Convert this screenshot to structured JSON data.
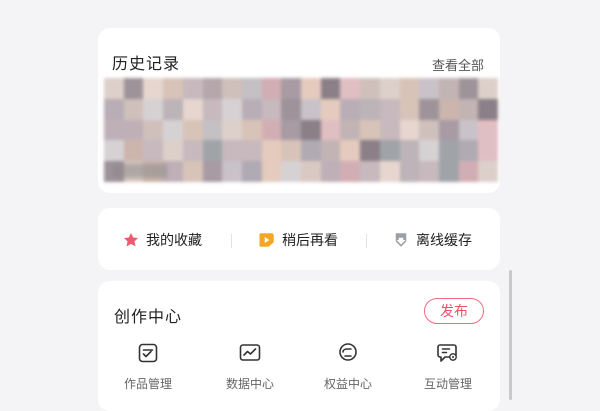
{
  "history": {
    "title": "历史记录",
    "view_all": "查看全部"
  },
  "quick_actions": [
    {
      "label": "我的收藏",
      "icon": "star-icon",
      "color": "#f05a6e"
    },
    {
      "label": "稍后再看",
      "icon": "play-later-icon",
      "color": "#f5a623"
    },
    {
      "label": "离线缓存",
      "icon": "download-icon",
      "color": "#9aa0a6"
    }
  ],
  "creator": {
    "title": "创作中心",
    "publish_label": "发布",
    "accent": "#f0506a",
    "tools": [
      {
        "label": "作品管理",
        "icon": "works-icon"
      },
      {
        "label": "数据中心",
        "icon": "chart-icon"
      },
      {
        "label": "权益中心",
        "icon": "benefit-icon"
      },
      {
        "label": "互动管理",
        "icon": "interaction-icon"
      }
    ]
  }
}
